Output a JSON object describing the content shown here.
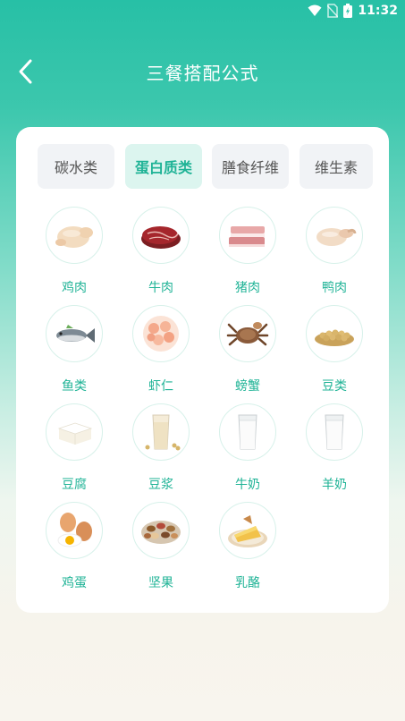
{
  "status": {
    "time": "11:32"
  },
  "header": {
    "title": "三餐搭配公式"
  },
  "tabs": [
    {
      "label": "碳水类",
      "active": false
    },
    {
      "label": "蛋白质类",
      "active": true
    },
    {
      "label": "膳食纤维",
      "active": false
    },
    {
      "label": "维生素",
      "active": false
    }
  ],
  "foods": [
    {
      "name": "鸡肉",
      "icon": "chicken-icon"
    },
    {
      "name": "牛肉",
      "icon": "beef-icon"
    },
    {
      "name": "猪肉",
      "icon": "pork-icon"
    },
    {
      "name": "鸭肉",
      "icon": "duck-icon"
    },
    {
      "name": "鱼类",
      "icon": "fish-icon"
    },
    {
      "name": "虾仁",
      "icon": "shrimp-icon"
    },
    {
      "name": "螃蟹",
      "icon": "crab-icon"
    },
    {
      "name": "豆类",
      "icon": "beans-icon"
    },
    {
      "name": "豆腐",
      "icon": "tofu-icon"
    },
    {
      "name": "豆浆",
      "icon": "soymilk-icon"
    },
    {
      "name": "牛奶",
      "icon": "milk-icon"
    },
    {
      "name": "羊奶",
      "icon": "goat-milk-icon"
    },
    {
      "name": "鸡蛋",
      "icon": "egg-icon"
    },
    {
      "name": "坚果",
      "icon": "nuts-icon"
    },
    {
      "name": "乳酪",
      "icon": "cheese-icon"
    }
  ],
  "colors": {
    "accent": "#1fb396",
    "header_bg": "#27c0a6",
    "tab_active_bg": "#dcf5ef"
  }
}
